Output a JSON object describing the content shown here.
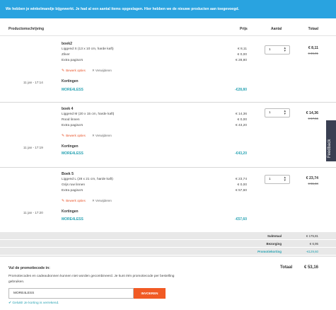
{
  "banner": "We hebben je winkelmandje bijgewerkt. Je had al een aantal items opgeslagen. Hier hebben we de nieuwe producten aan toegevoegd.",
  "columns": {
    "description": "Productomschrijving",
    "price": "Prijs",
    "quantity": "Aantal",
    "total": "Totaal"
  },
  "items": [
    {
      "date": "11 jan - 17:14",
      "title": "boek2",
      "specs": [
        "Liggend S (13 x 10 cm, harde kaft)",
        "Zilver",
        "Extra pagina's"
      ],
      "prices": [
        "€ 8,11",
        "€ 0,00",
        "€ 28,80"
      ],
      "edit": "Bewerk opties",
      "remove": "Verwijderen",
      "discount_label": "Kortingen",
      "discount_code": "MORE4LESS",
      "discount_amount": "-€28,80",
      "quantity": "1",
      "total_now": "€ 8,11",
      "total_old": "€ 36,91"
    },
    {
      "date": "11 jan - 17:19",
      "title": "boek 4",
      "specs": [
        "Liggend M (20 x 15 cm, harde kaft)",
        "Rood linnen",
        "Extra pagina's"
      ],
      "prices": [
        "€ 14,36",
        "€ 0,00",
        "€ 43,20"
      ],
      "edit": "Bewerk opties",
      "remove": "Verwijderen",
      "discount_label": "Kortingen",
      "discount_code": "MORE4LESS",
      "discount_amount": "-€43,20",
      "quantity": "1",
      "total_now": "€ 14,36",
      "total_old": "€ 57,56"
    },
    {
      "date": "11 jan - 17:20",
      "title": "Boek 5",
      "specs": [
        "Liggend L (28 x 21 cm, harde kaft)",
        "Grijs ruw linnen",
        "Extra pagina's"
      ],
      "prices": [
        "€ 23,74",
        "€ 0,00",
        "€ 57,60"
      ],
      "edit": "Bewerk opties",
      "remove": "Verwijderen",
      "discount_label": "Kortingen",
      "discount_code": "MORE4LESS",
      "discount_amount": "-€57,60",
      "quantity": "1",
      "total_now": "€ 23,74",
      "total_old": "€ 81,34"
    }
  ],
  "summary": {
    "subtotal_label": "Subtotaal",
    "subtotal": "€ 175,81",
    "shipping_label": "Bezorging",
    "shipping": "€ 6,95",
    "promo_label": "Promotiekorting",
    "promo": "-€129,60"
  },
  "promo": {
    "title": "Vul de promotiecode in:",
    "text": "Promotiecodes en cadeaubonnen kunnen niet worden gecombineerd. Je kunt één promotiecode per bestelling gebruiken.",
    "code_value": "MORE4LESS",
    "button": "INVOEREN",
    "success": "Gelukt! Je korting is verrekend."
  },
  "grand_total_label": "Totaal",
  "grand_total": "€ 53,16",
  "feedback": "Feedback",
  "icons": {
    "edit": "pencil-icon",
    "remove": "close-icon",
    "quantity": "chevron-updown-icon",
    "success": "check-icon"
  },
  "colors": {
    "accent": "#29a3e0",
    "teal": "#29a3b3",
    "orange": "#f15a24",
    "feedback": "#3a3f52"
  }
}
